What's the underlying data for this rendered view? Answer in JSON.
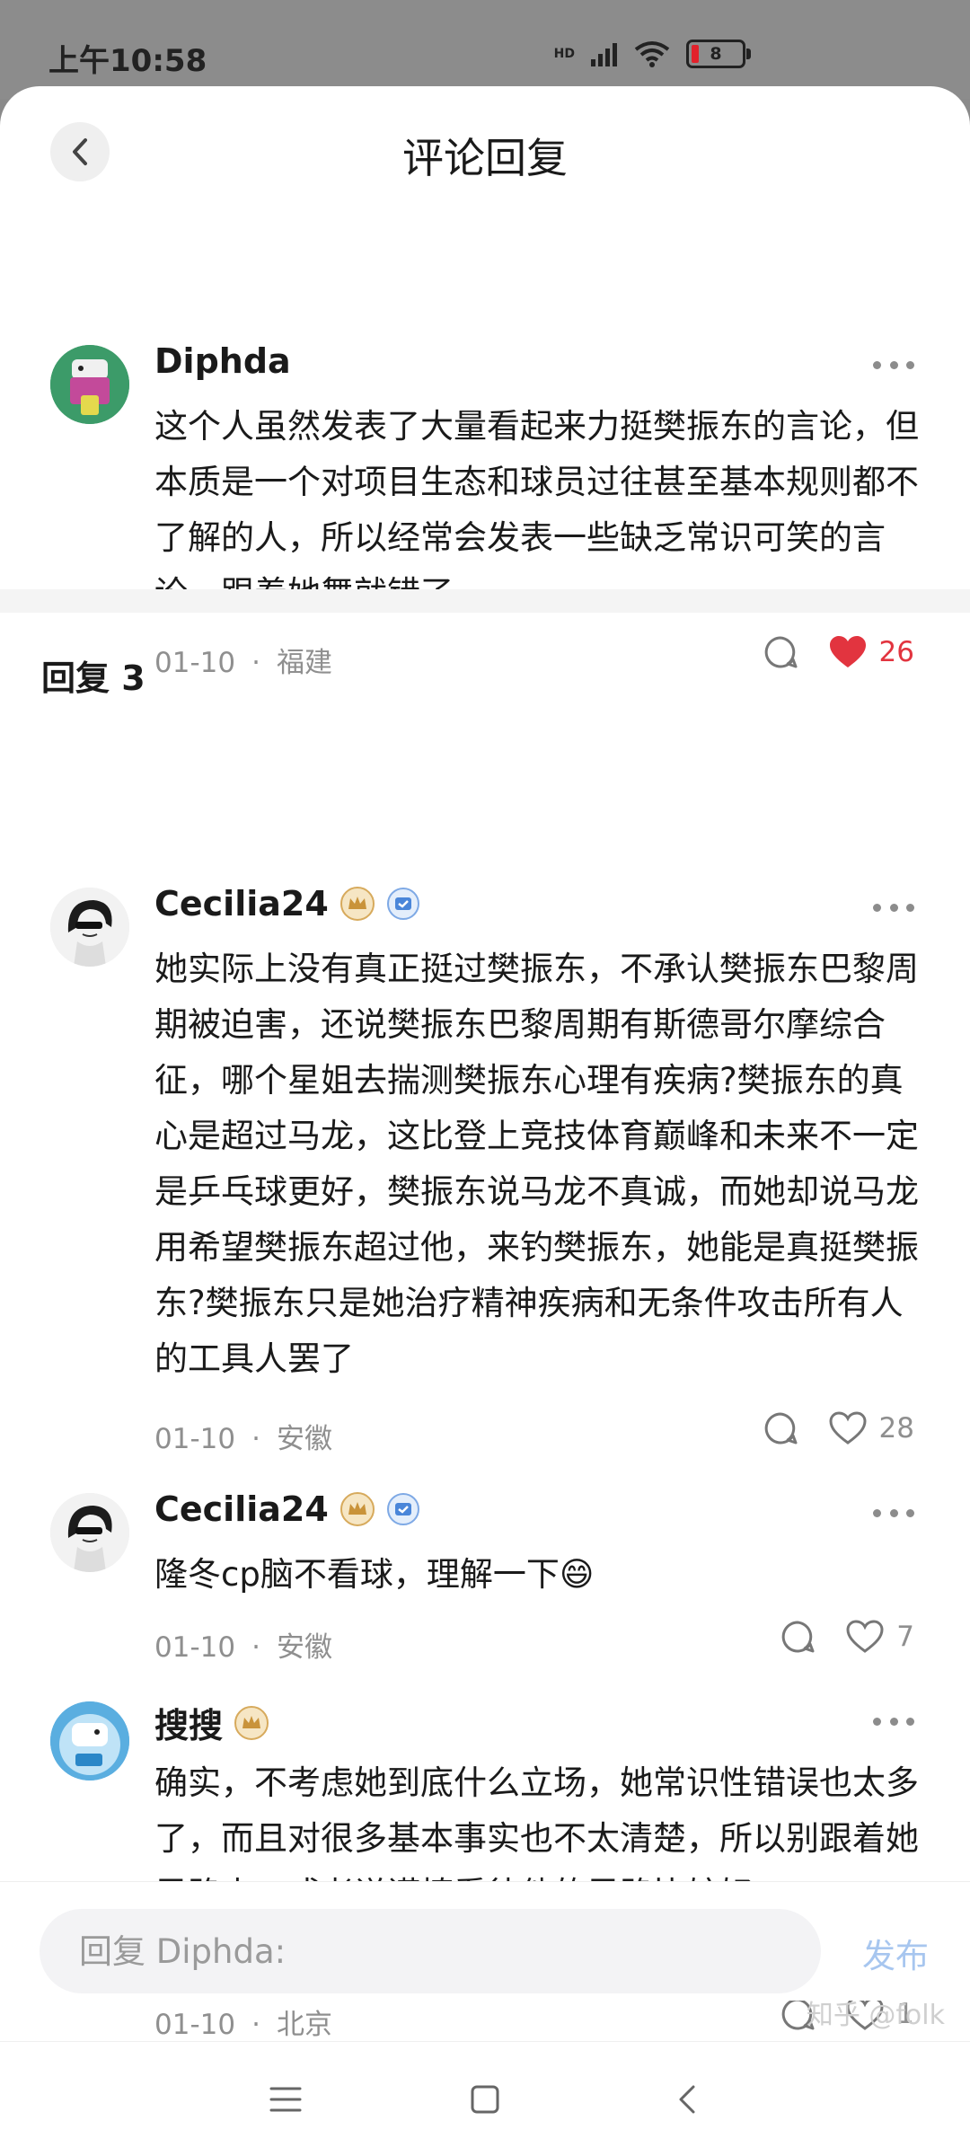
{
  "status": {
    "time": "上午10:58",
    "network": "HD",
    "battery": "8"
  },
  "header": {
    "title": "评论回复"
  },
  "main_comment": {
    "author": "Diphda",
    "text": "这个人虽然发表了大量看起来力挺樊振东的言论，但本质是一个对项目生态和球员过往甚至基本规则都不了解的人，所以经常会发表一些缺乏常识可笑的言论。跟着她舞就错了。",
    "date": "01-10",
    "location": "福建",
    "likes": "26",
    "liked": true
  },
  "replies": {
    "title": "回复 3",
    "items": [
      {
        "author": "Cecilia24",
        "text": "她实际上没有真正挺过樊振东，不承认樊振东巴黎周期被迫害，还说樊振东巴黎周期有斯德哥尔摩综合征，哪个星姐去揣测樊振东心理有疾病?樊振东的真心是超过马龙，这比登上竞技体育巅峰和未来不一定是乒乓球更好，樊振东说马龙不真诚，而她却说马龙用希望樊振东超过他，来钓樊振东，她能是真挺樊振东?樊振东只是她治疗精神疾病和无条件攻击所有人的工具人罢了",
        "date": "01-10",
        "location": "安徽",
        "likes": "28"
      },
      {
        "author": "Cecilia24",
        "text": "隆冬cp脑不看球，理解一下😄",
        "date": "01-10",
        "location": "安徽",
        "likes": "7"
      },
      {
        "author": "搜搜",
        "text": "确实，不考虑她到底什么立场，她常识性错误也太多了，而且对很多基本事实也不太清楚，所以别跟着她思路走，或者说谨慎看待他的思路比较好。",
        "date": "01-10",
        "location": "北京",
        "likes": "1"
      }
    ]
  },
  "input": {
    "placeholder": "回复 Diphda:",
    "publish_label": "发布"
  },
  "watermark": "知乎 @folk",
  "colors": {
    "like_red": "#e2343f",
    "publish_blue": "#a7c6ef",
    "meta_gray": "#8f8f8f"
  }
}
